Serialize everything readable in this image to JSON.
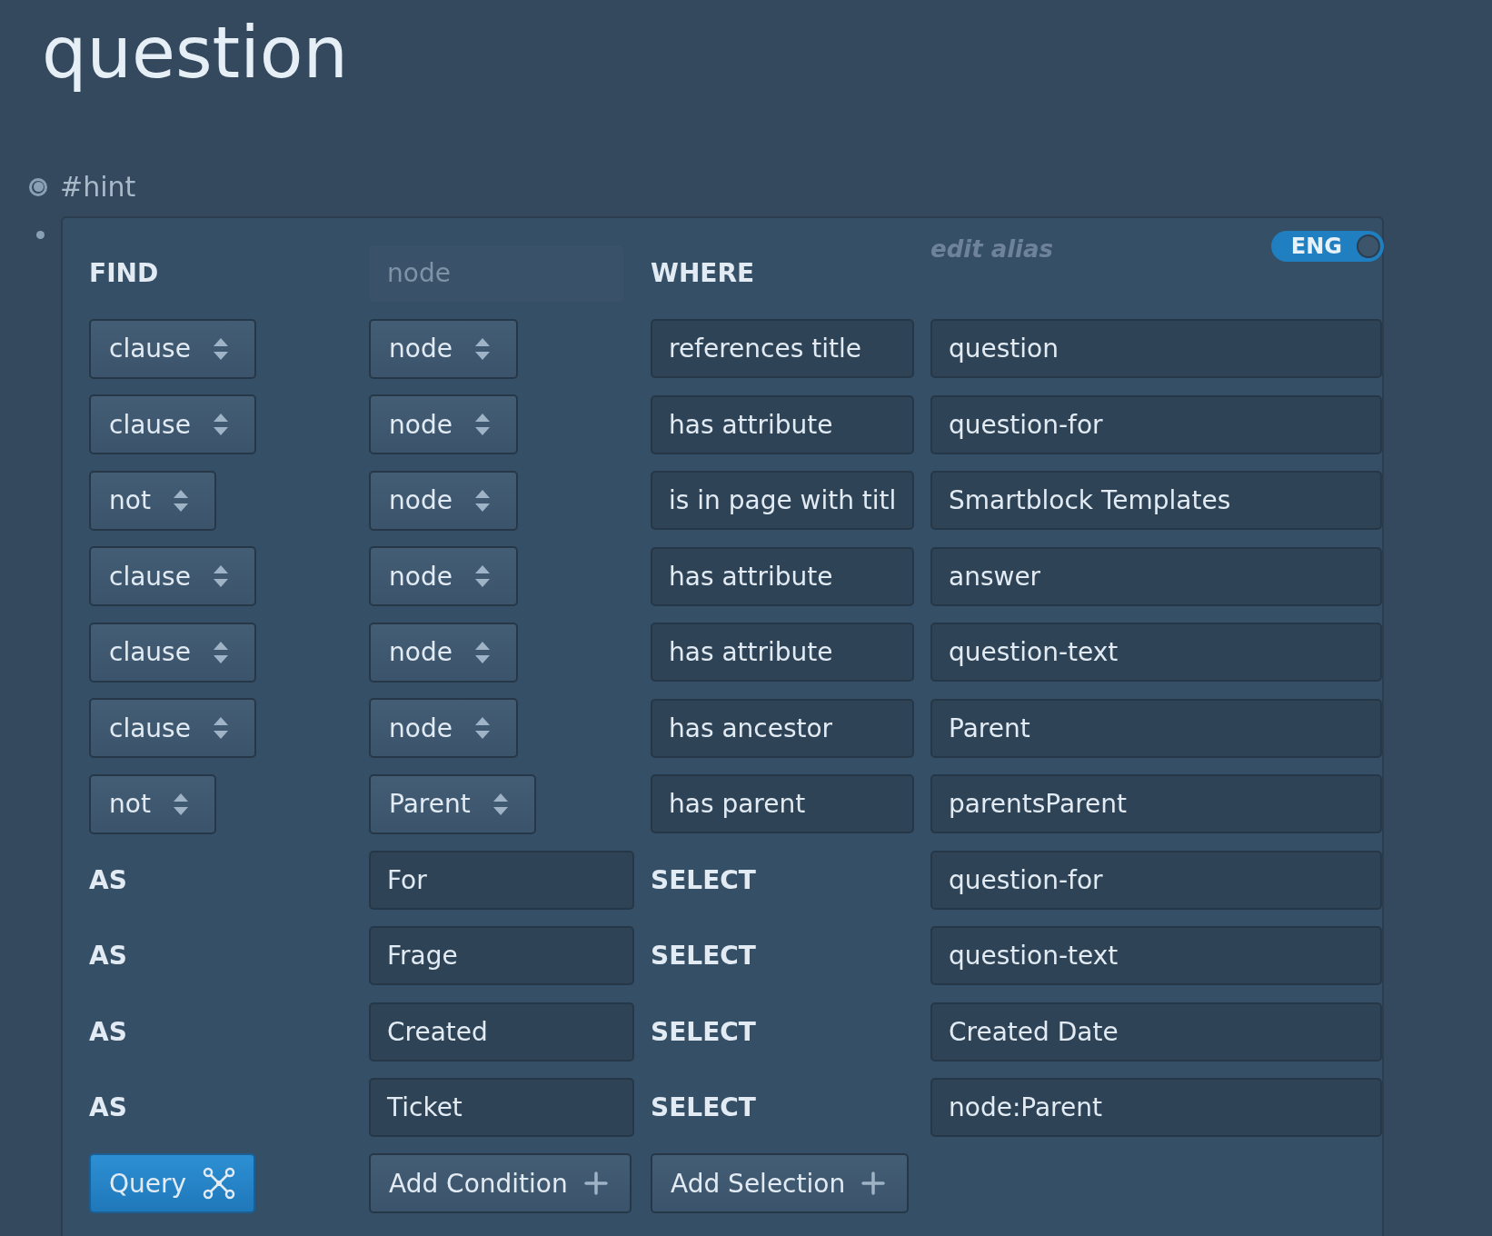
{
  "page_title": "question",
  "block": {
    "tag": "#hint",
    "collapsed": true
  },
  "query": {
    "find_label": "FIND",
    "find_input": {
      "placeholder": "node"
    },
    "where_label": "WHERE",
    "alias_input": {
      "placeholder": "edit alias"
    },
    "language_toggle": {
      "label": "ENG",
      "on": true
    },
    "conditions": [
      {
        "type": "clause",
        "source": "node",
        "relation": "references title",
        "value": "question"
      },
      {
        "type": "clause",
        "source": "node",
        "relation": "has attribute",
        "value": "question-for"
      },
      {
        "type": "not",
        "source": "node",
        "relation": "is in page with titl",
        "value": "Smartblock Templates"
      },
      {
        "type": "clause",
        "source": "node",
        "relation": "has attribute",
        "value": "answer"
      },
      {
        "type": "clause",
        "source": "node",
        "relation": "has attribute",
        "value": "question-text"
      },
      {
        "type": "clause",
        "source": "node",
        "relation": "has ancestor",
        "value": "Parent"
      },
      {
        "type": "not",
        "source": "Parent",
        "relation": "has parent",
        "value": "parentsParent"
      }
    ],
    "selections": [
      {
        "as_label": "AS",
        "alias": "For",
        "select_label": "SELECT",
        "value": "question-for"
      },
      {
        "as_label": "AS",
        "alias": "Frage",
        "select_label": "SELECT",
        "value": "question-text"
      },
      {
        "as_label": "AS",
        "alias": "Created",
        "select_label": "SELECT",
        "value": "Created Date"
      },
      {
        "as_label": "AS",
        "alias": "Ticket",
        "select_label": "SELECT",
        "value": "node:Parent"
      }
    ],
    "buttons": {
      "query": "Query",
      "add_condition": "Add Condition",
      "add_selection": "Add Selection"
    }
  }
}
